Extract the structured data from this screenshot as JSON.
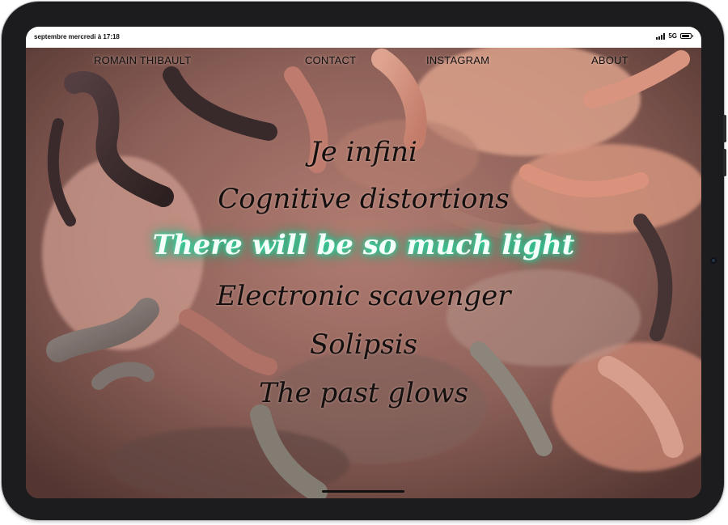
{
  "status_bar": {
    "time": "septembre mercredi à 17:18",
    "network": "5G"
  },
  "nav": {
    "items": [
      {
        "label": "ROMAIN THIBAULT"
      },
      {
        "label": "CONTACT"
      },
      {
        "label": "INSTAGRAM"
      },
      {
        "label": "ABOUT"
      }
    ]
  },
  "menu": {
    "items": [
      {
        "label": "Je infini"
      },
      {
        "label": "Cognitive distortions"
      },
      {
        "label": "There will be so much light",
        "active": true
      },
      {
        "label": "Electronic scavenger"
      },
      {
        "label": "Solipsis"
      },
      {
        "label": "The past glows"
      }
    ]
  },
  "colors": {
    "active_glow": "#2fe0a8",
    "menu_text": "#141010",
    "device_frame": "#1c1c1e"
  }
}
